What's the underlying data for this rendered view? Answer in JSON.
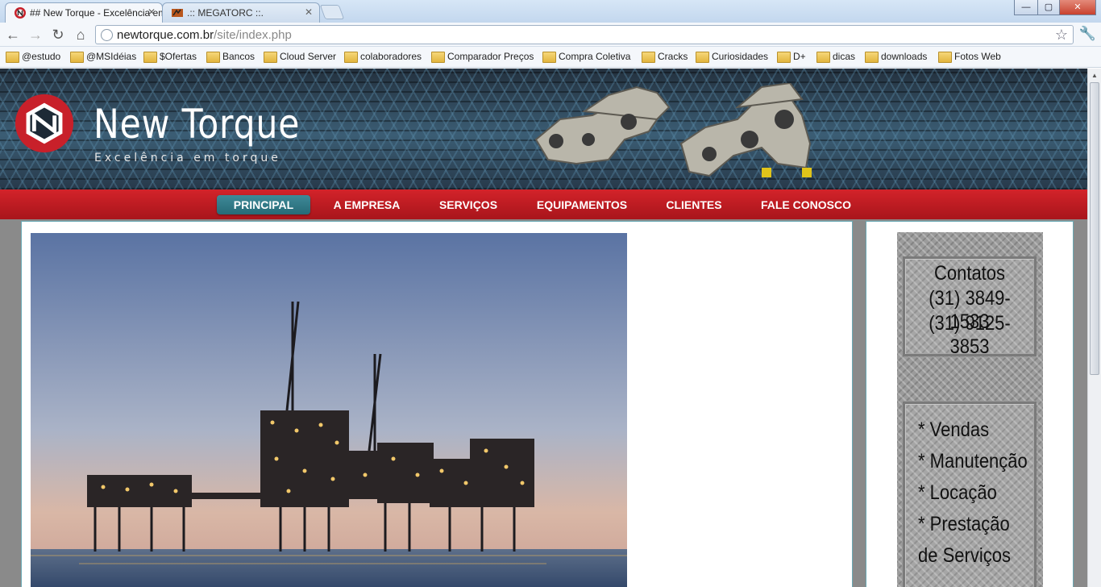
{
  "browser": {
    "tabs": [
      {
        "title": "## New Torque - Excelência em torque",
        "active": true
      },
      {
        "title": ".:: MEGATORC ::.",
        "active": false
      }
    ],
    "url_domain": "newtorque.com.br",
    "url_path": "/site/index.php",
    "bookmarks": [
      "@estudo",
      "@MSIdéias",
      "$Ofertas",
      "Bancos",
      "Cloud Server",
      "colaboradores",
      "Comparador Preços",
      "Compra Coletiva",
      "Cracks",
      "Curiosidades",
      "D+",
      "dicas",
      "downloads",
      "Fotos Web"
    ],
    "window_controls": {
      "minimize": "—",
      "maximize": "▢",
      "close": "✕"
    }
  },
  "site": {
    "brand": "New Torque",
    "tagline": "Excelência em torque",
    "nav": [
      {
        "label": "PRINCIPAL",
        "active": true
      },
      {
        "label": "A EMPRESA",
        "active": false
      },
      {
        "label": "SERVIÇOS",
        "active": false
      },
      {
        "label": "EQUIPAMENTOS",
        "active": false
      },
      {
        "label": "CLIENTES",
        "active": false
      },
      {
        "label": "FALE CONOSCO",
        "active": false
      }
    ],
    "contacts": {
      "title": "Contatos",
      "phones": [
        "(31) 3849-1533",
        "(31) 9125-3853"
      ]
    },
    "services": [
      "* Vendas",
      "* Manutenção",
      "* Locação",
      "* Prestação",
      "de Serviços"
    ]
  },
  "colors": {
    "nav_red": "#c81e24",
    "nav_active": "#2f7885",
    "box_border": "#6aa9b5"
  }
}
